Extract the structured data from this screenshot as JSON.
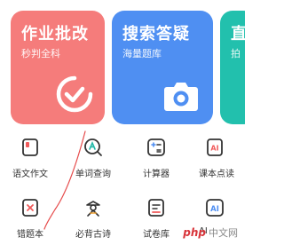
{
  "cards": [
    {
      "title": "作业批改",
      "subtitle": "秒判全科",
      "icon": "check-circle-icon",
      "color": "#f57c7b"
    },
    {
      "title": "搜索答疑",
      "subtitle": "海量题库",
      "icon": "camera-icon",
      "color": "#4f8ff2"
    },
    {
      "title": "直",
      "subtitle": "拍",
      "icon": "",
      "color": "#22c0ad"
    }
  ],
  "tools": [
    {
      "label": "语文作文",
      "icon": "notebook-icon"
    },
    {
      "label": "单词查询",
      "icon": "word-search-icon"
    },
    {
      "label": "计算器",
      "icon": "calculator-icon"
    },
    {
      "label": "课本点读",
      "icon": "ai-book-icon"
    },
    {
      "label": "错题本",
      "icon": "error-book-icon"
    },
    {
      "label": "必背古诗",
      "icon": "poetry-figure-icon"
    },
    {
      "label": "试卷库",
      "icon": "exam-paper-icon"
    },
    {
      "label": "AI",
      "icon": "ai-icon"
    }
  ],
  "watermark": {
    "logo": "php",
    "text": "中文网"
  }
}
